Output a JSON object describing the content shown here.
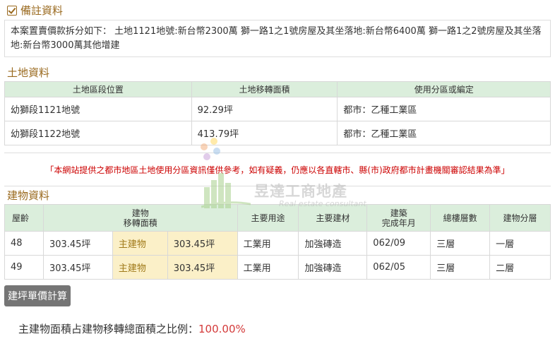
{
  "remarks": {
    "title": "備註資料",
    "text": "本案置賣價款拆分如下： 土地1121地號:新台幣2300萬 獅一路1之1號房屋及其坐落地:新台幣6400萬 獅一路1之2號房屋及其坐落地:新台幣3000萬其他增建"
  },
  "land": {
    "title": "土地資料",
    "headers": [
      "土地區段位置",
      "土地移轉面積",
      "使用分區或編定"
    ],
    "rows": [
      [
        "幼獅段1121地號",
        "92.29坪",
        "都市：乙種工業區"
      ],
      [
        "幼獅段1122地號",
        "413.79坪",
        "都市：乙種工業區"
      ]
    ]
  },
  "notice": "「本網站提供之都市地區土地使用分區資訊僅供參考，如有疑義，仍應以各直轄市、縣(市)政府都市計畫機關審認結果為準」",
  "building": {
    "title": "建物資料",
    "headers": {
      "age": "屋齡",
      "area_l1": "建物",
      "area_l2": "移轉面積",
      "use": "主要用途",
      "material": "主要建材",
      "built_l1": "建築",
      "built_l2": "完成年月",
      "floors": "總樓層數",
      "level": "建物分層"
    },
    "rows": [
      {
        "age": "48",
        "area": "303.45坪",
        "kind": "主建物",
        "kind_area": "303.45坪",
        "use": "工業用",
        "material": "加強磚造",
        "built": "062/09",
        "floors": "三層",
        "level": "一層"
      },
      {
        "age": "49",
        "area": "303.45坪",
        "kind": "主建物",
        "kind_area": "303.45坪",
        "use": "工業用",
        "material": "加強磚造",
        "built": "062/05",
        "floors": "三層",
        "level": "二層"
      }
    ]
  },
  "calc_button": "建坪單價計算",
  "ratio": {
    "label": "主建物面積占建物移轉總面積之比例：",
    "value": "100.00%"
  },
  "watermark": {
    "name": "昱達工商地產",
    "subtitle": "Real estate consultant"
  },
  "colors": {
    "section_title": "#9a6a1f",
    "table_header": "#dbeedc",
    "highlight_cell": "#fbf0c8",
    "notice_red": "#cc0000",
    "ratio_red": "#d43a3a",
    "button_bg": "#757575"
  }
}
